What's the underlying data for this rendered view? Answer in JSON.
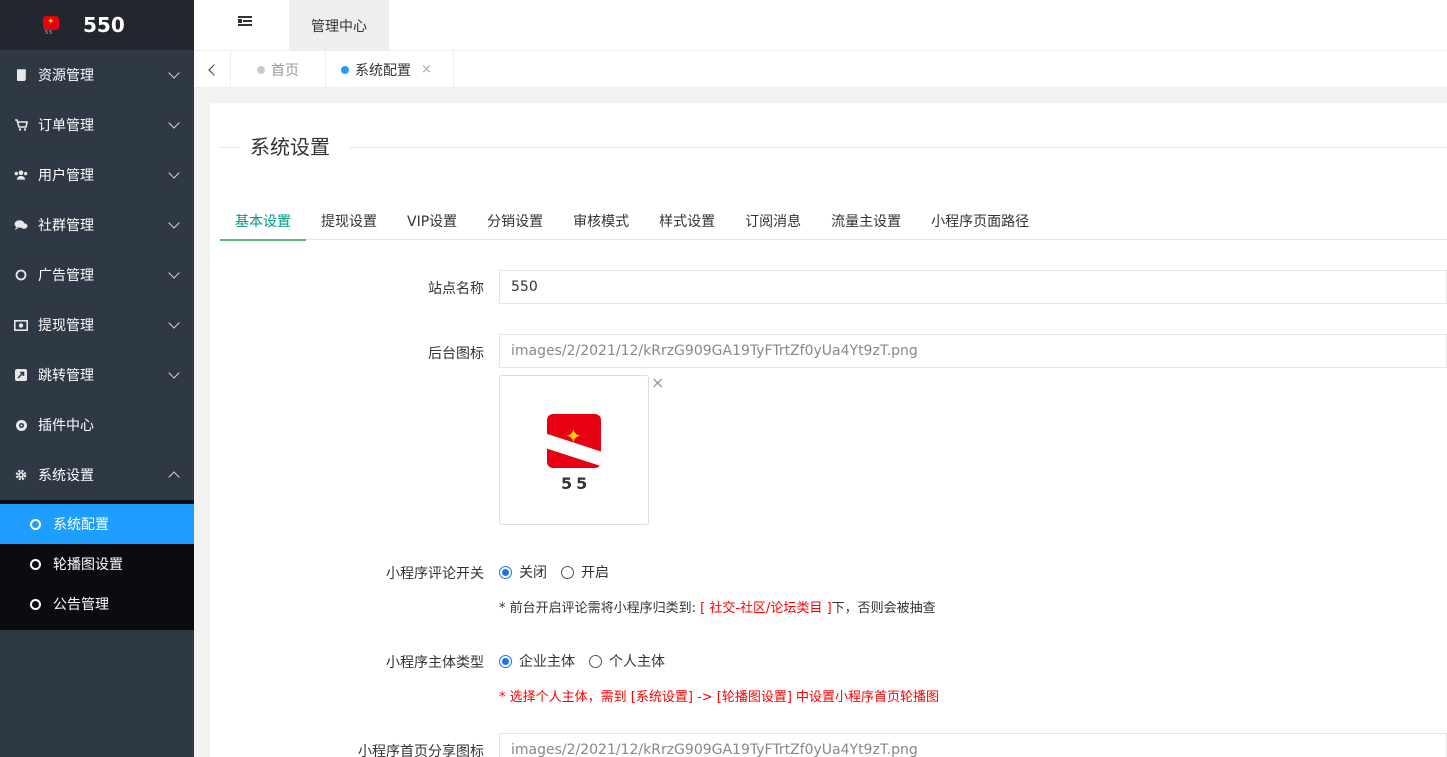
{
  "app": {
    "logo_text": "550",
    "logo_mark_text": "55"
  },
  "sidebar": {
    "items": [
      {
        "label": "资源管理",
        "icon": "book-icon"
      },
      {
        "label": "订单管理",
        "icon": "cart-icon"
      },
      {
        "label": "用户管理",
        "icon": "users-icon"
      },
      {
        "label": "社群管理",
        "icon": "comments-icon"
      },
      {
        "label": "广告管理",
        "icon": "circle-icon"
      },
      {
        "label": "提现管理",
        "icon": "money-icon"
      },
      {
        "label": "跳转管理",
        "icon": "external-link-icon"
      },
      {
        "label": "插件中心",
        "icon": "plugin-icon"
      },
      {
        "label": "系统设置",
        "icon": "gear-icon"
      }
    ],
    "submenu": [
      {
        "label": "系统配置",
        "active": true
      },
      {
        "label": "轮播图设置",
        "active": false
      },
      {
        "label": "公告管理",
        "active": false
      }
    ]
  },
  "header": {
    "tab_label": "管理中心"
  },
  "page_tabs": {
    "home": "首页",
    "current": "系统配置",
    "close": "×"
  },
  "content": {
    "section_title": "系统设置",
    "tabs": [
      "基本设置",
      "提现设置",
      "VIP设置",
      "分销设置",
      "审核模式",
      "样式设置",
      "订阅消息",
      "流量主设置",
      "小程序页面路径"
    ],
    "site_name": {
      "label": "站点名称",
      "value": "550"
    },
    "admin_icon": {
      "label": "后台图标",
      "value": "images/2/2021/12/kRrzG909GA19TyFTrtZf0yUa4Yt9zT.png",
      "remove": "×"
    },
    "comment_switch": {
      "label": "小程序评论开关",
      "options": [
        "关闭",
        "开启"
      ],
      "selected": "关闭",
      "hint_prefix": "* 前台开启评论需将小程序归类到: ",
      "hint_red": "[ 社交-社区/论坛类目 ]",
      "hint_suffix": "下，否则会被抽查"
    },
    "subject_type": {
      "label": "小程序主体类型",
      "options": [
        "企业主体",
        "个人主体"
      ],
      "selected": "企业主体",
      "hint": "* 选择个人主体，需到 [系统设置] -> [轮播图设置] 中设置小程序首页轮播图"
    },
    "share_icon": {
      "label": "小程序首页分享图标",
      "value": "images/2/2021/12/kRrzG909GA19TyFTrtZf0yUa4Yt9zT.png"
    }
  }
}
